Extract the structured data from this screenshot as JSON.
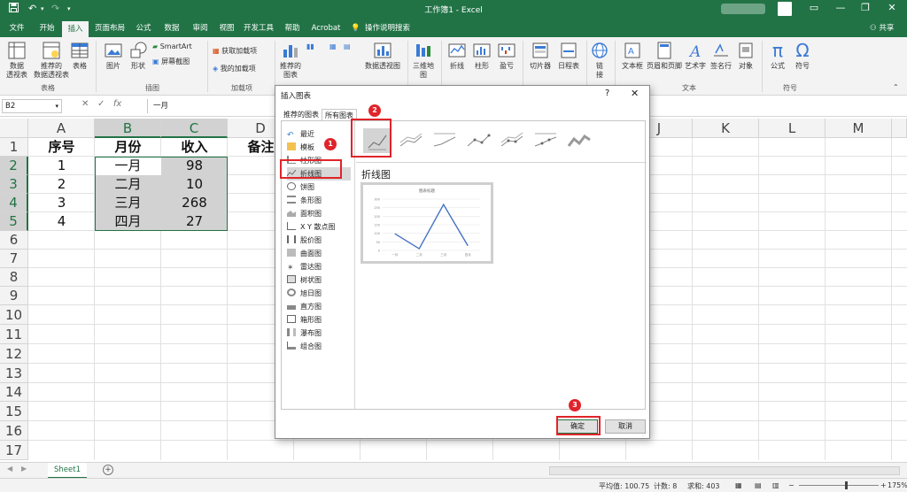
{
  "titlebar": {
    "title": "工作簿1 - Excel",
    "undo_icon": "undo-icon",
    "redo_icon": "redo-icon",
    "save_icon": "save-icon"
  },
  "menu": {
    "tabs": [
      "文件",
      "开始",
      "插入",
      "页面布局",
      "公式",
      "数据",
      "审阅",
      "视图",
      "开发工具",
      "帮助",
      "Acrobat",
      "操作说明搜索"
    ],
    "active": "插入",
    "share": "共享"
  },
  "ribbon": {
    "buttons": {
      "pivot": "数据\n透视表",
      "rec_pivot": "推荐的\n数据透视表",
      "table": "表格",
      "picture": "图片",
      "shapes": "形状",
      "smartart": "SmartArt",
      "screenshot": "屏幕截图",
      "get_addins": "获取加载项",
      "my_addins": "我的加载项",
      "rec_chart": "推荐的\n图表",
      "pivot_chart": "数据透视图",
      "map3d": "三维地\n图",
      "spark_line": "折线",
      "spark_col": "柱形",
      "spark_wl": "盈亏",
      "slicer": "切片器",
      "timeline": "日程表",
      "link": "链\n接",
      "textbox": "文本框",
      "header": "页眉和页脚",
      "wordart": "艺术字",
      "signature": "签名行",
      "object": "对象",
      "equation": "公式",
      "symbol": "符号"
    },
    "groups": {
      "tables": "表格",
      "illustrations": "插图",
      "addins": "加载项",
      "text": "文本",
      "symbols": "符号"
    }
  },
  "formula_bar": {
    "name_box": "B2",
    "formula": "一月",
    "fx": "fx"
  },
  "grid": {
    "columns": [
      "A",
      "B",
      "C",
      "D",
      "E",
      "F",
      "G",
      "H",
      "I",
      "J",
      "K",
      "L",
      "M"
    ],
    "rows": [
      "1",
      "2",
      "3",
      "4",
      "5",
      "6",
      "7",
      "8",
      "9",
      "10",
      "11",
      "12",
      "13",
      "14",
      "15",
      "16",
      "17"
    ],
    "headers": [
      "序号",
      "月份",
      "收入",
      "备注"
    ],
    "data": [
      [
        "1",
        "一月",
        "98"
      ],
      [
        "2",
        "二月",
        "10"
      ],
      [
        "3",
        "三月",
        "268"
      ],
      [
        "4",
        "四月",
        "27"
      ]
    ]
  },
  "sheet_tabs": {
    "active": "Sheet1"
  },
  "status_bar": {
    "average": "平均值: 100.75",
    "count": "计数: 8",
    "sum": "求和: 403",
    "zoom": "175%"
  },
  "dialog": {
    "title": "插入图表",
    "help": "?",
    "tabs": [
      "推荐的图表",
      "所有图表"
    ],
    "active_tab": "所有图表",
    "chart_types": [
      "最近",
      "模板",
      "柱形图",
      "折线图",
      "饼图",
      "条形图",
      "面积图",
      "X Y 散点图",
      "股价图",
      "曲面图",
      "雷达图",
      "树状图",
      "旭日图",
      "直方图",
      "箱形图",
      "瀑布图",
      "组合图"
    ],
    "selected_type": "折线图",
    "subtype_title": "折线图",
    "preview_title": "图表标题",
    "ok": "确定",
    "cancel": "取消"
  },
  "annotations": [
    "1",
    "2",
    "3"
  ],
  "colors": {
    "excel_green": "#217346",
    "annotation_red": "#e0242a",
    "series_blue": "#4472c4"
  },
  "chart_data": {
    "type": "line",
    "categories": [
      "一月",
      "二月",
      "三月",
      "四月"
    ],
    "values": [
      98,
      10,
      268,
      27
    ],
    "title": "图表标题",
    "ylim": [
      0,
      300
    ],
    "grid": true,
    "legend": "none"
  }
}
